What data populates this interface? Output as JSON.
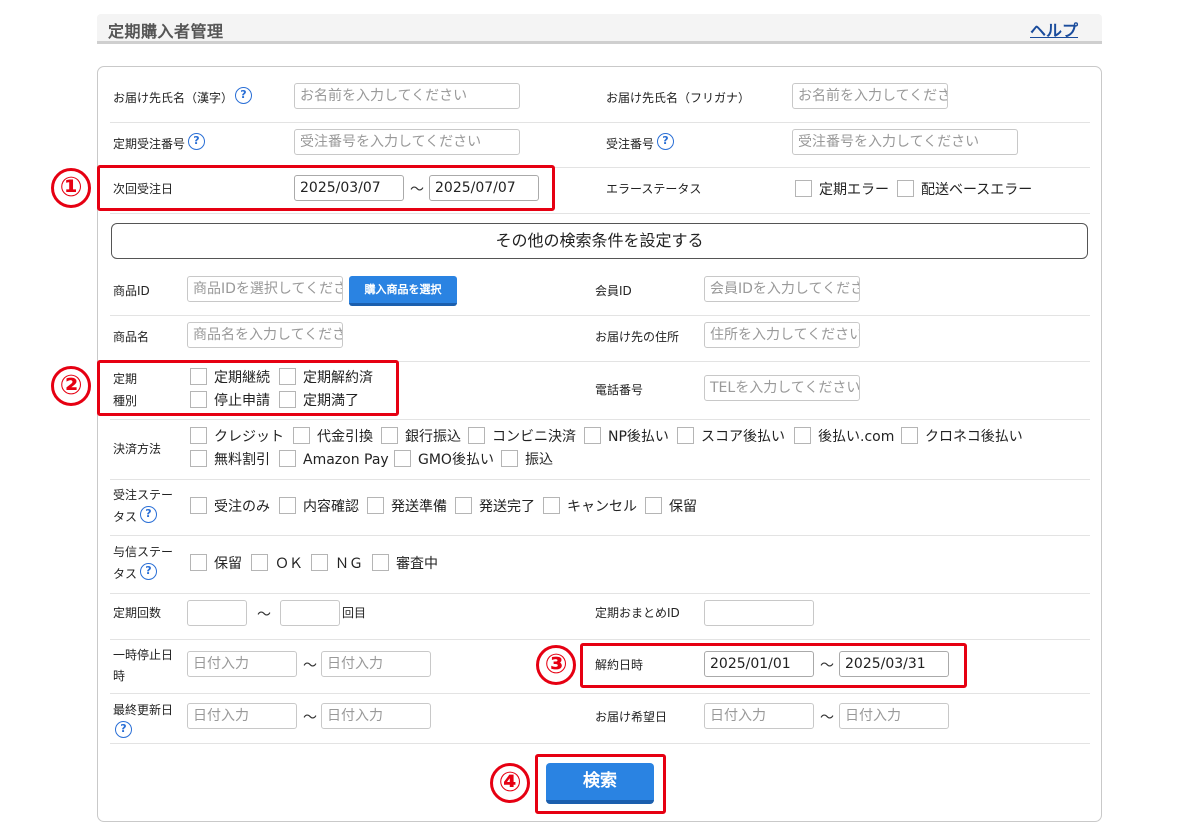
{
  "header": {
    "title": "定期購入者管理",
    "help": "ヘルプ"
  },
  "basic": {
    "name_kanji": {
      "label": "お届け先氏名（漢字）",
      "placeholder": "お名前を入力してください"
    },
    "name_kana": {
      "label": "お届け先氏名（フリガナ）",
      "placeholder": "お名前を入力してくださ"
    },
    "sub_order_no": {
      "label": "定期受注番号",
      "placeholder": "受注番号を入力してください"
    },
    "order_no": {
      "label": "受注番号",
      "placeholder": "受注番号を入力してください"
    },
    "next_order_date": {
      "label": "次回受注日",
      "from": "2025/03/07",
      "to": "2025/07/07"
    },
    "error_status": {
      "label": "エラーステータス",
      "options": [
        "定期エラー",
        "配送ベースエラー"
      ]
    }
  },
  "more_conditions": "その他の検索条件を設定する",
  "product_id": {
    "label": "商品ID",
    "placeholder": "商品IDを選択してくださ",
    "button": "購入商品を選択"
  },
  "member_id": {
    "label": "会員ID",
    "placeholder": "会員IDを入力してくださ"
  },
  "product_name": {
    "label": "商品名",
    "placeholder": "商品名を入力してくださ"
  },
  "address": {
    "label": "お届け先の住所",
    "placeholder": "住所を入力してください"
  },
  "sub_type": {
    "label1": "定期",
    "label2": "種別",
    "options": [
      "定期継続",
      "定期解約済",
      "停止申請",
      "定期満了"
    ]
  },
  "phone": {
    "label": "電話番号",
    "placeholder": "TELを入力してください"
  },
  "payment": {
    "label": "決済方法",
    "options": [
      "クレジット",
      "代金引換",
      "銀行振込",
      "コンビニ決済",
      "NP後払い",
      "スコア後払い",
      "後払い.com",
      "クロネコ後払い",
      "無料割引",
      "Amazon Pay",
      "GMO後払い",
      "振込"
    ]
  },
  "order_status": {
    "label1": "受注ステー",
    "label2": "タス",
    "options": [
      "受注のみ",
      "内容確認",
      "発送準備",
      "発送完了",
      "キャンセル",
      "保留"
    ]
  },
  "credit_status": {
    "label1": "与信ステー",
    "label2": "タス",
    "options": [
      "保留",
      "ＯＫ",
      "ＮＧ",
      "審査中"
    ]
  },
  "sub_count": {
    "label": "定期回数",
    "unit": "回目"
  },
  "bundle_id": {
    "label": "定期おまとめID"
  },
  "pause_date": {
    "label1": "一時停止日",
    "label2": "時",
    "from_placeholder": "日付入力",
    "to_placeholder": "日付入力"
  },
  "cancel_date": {
    "label": "解約日時",
    "from": "2025/01/01",
    "to": "2025/03/31"
  },
  "updated_date": {
    "label": "最終更新日",
    "from_placeholder": "日付入力",
    "to_placeholder": "日付入力"
  },
  "delivery_date": {
    "label": "お届け希望日",
    "from_placeholder": "日付入力",
    "to_placeholder": "日付入力"
  },
  "tilde": "〜",
  "help_mark": "?",
  "search_button": "検索",
  "markers": [
    "①",
    "②",
    "③",
    "④"
  ],
  "colors": {
    "accent_blue": "#2a83e2",
    "highlight_red": "#e60012",
    "link": "#1a4c9c"
  }
}
